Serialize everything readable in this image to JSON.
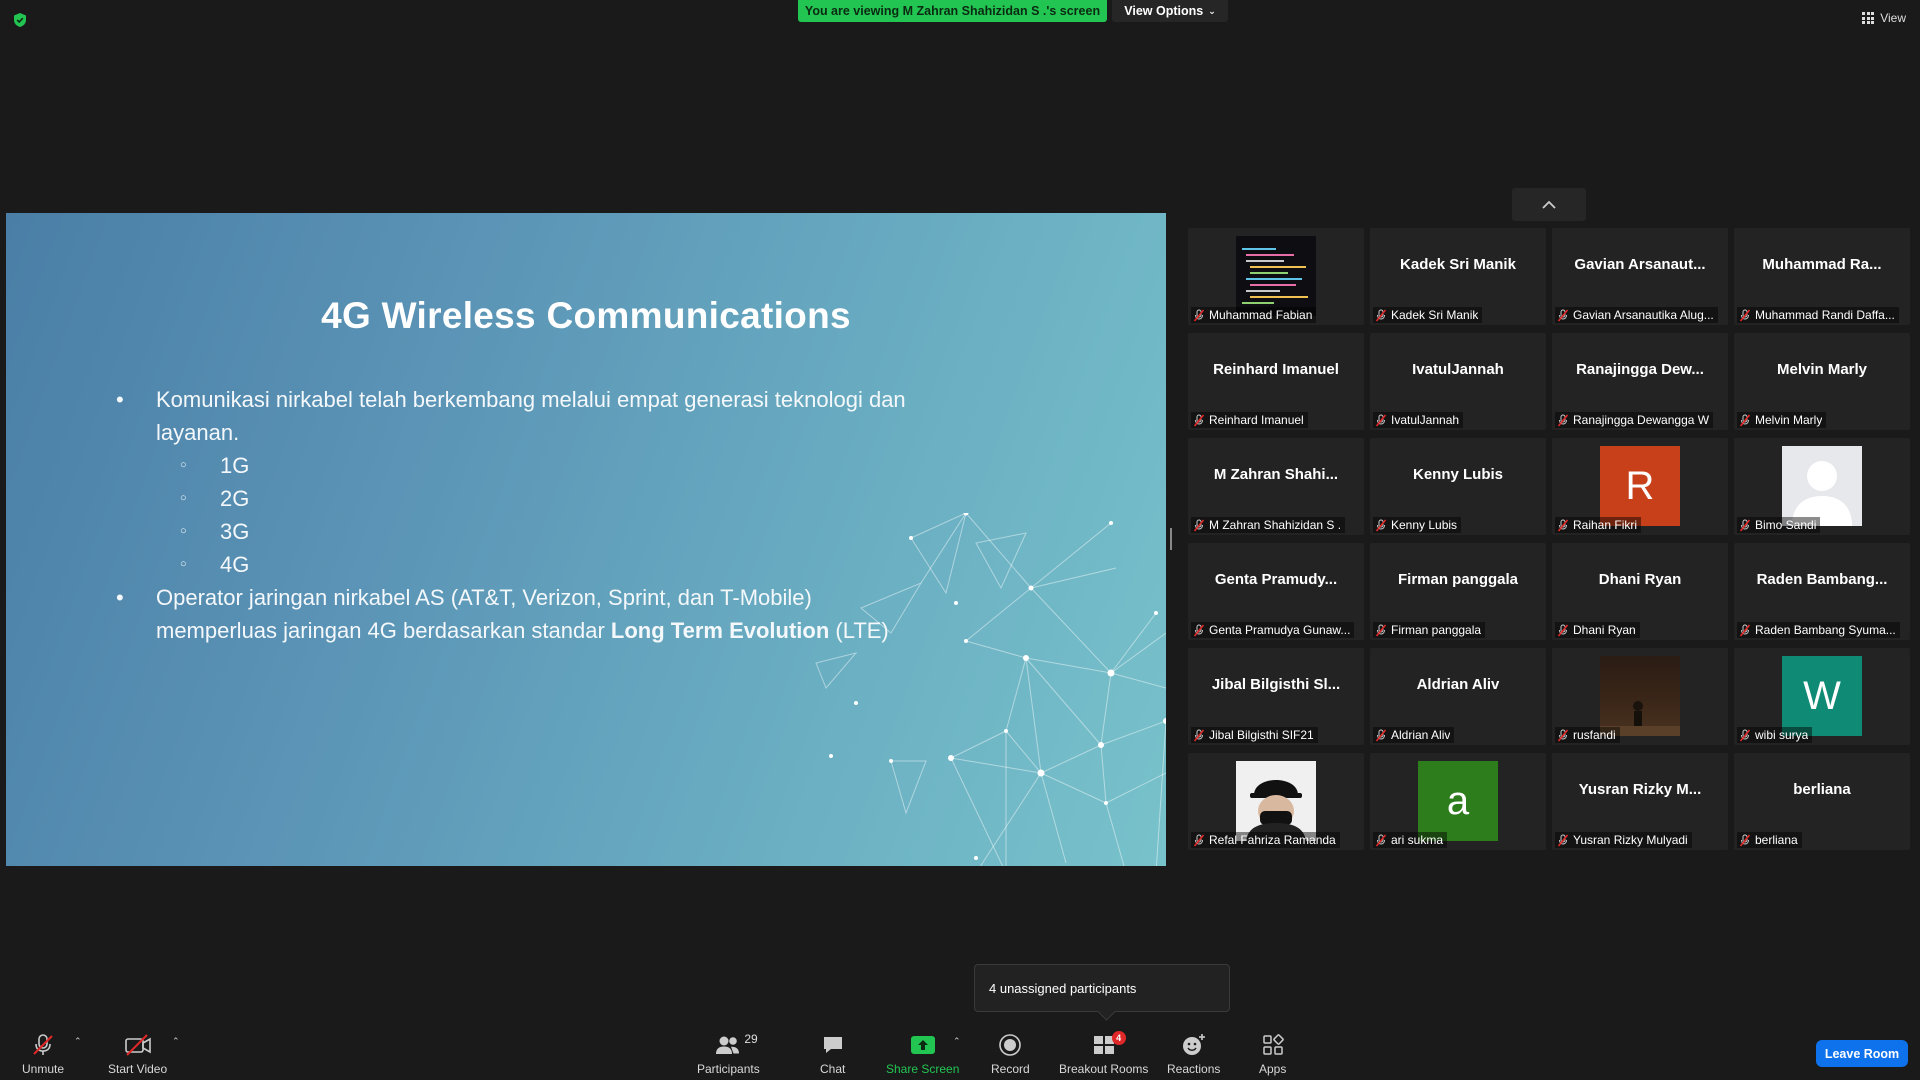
{
  "top_bar": {
    "viewing_banner": "You are viewing M Zahran Shahizidan S .'s screen",
    "view_options_label": "View Options",
    "view_label": "View"
  },
  "slide": {
    "title": "4G Wireless Communications",
    "bullet1": "Komunikasi nirkabel telah berkembang melalui empat generasi teknologi dan layanan.",
    "sub_items": [
      "1G",
      "2G",
      "3G",
      "4G"
    ],
    "bullet2_part1": "Operator jaringan nirkabel AS (AT&T, Verizon, Sprint, dan T-Mobile) memperluas jaringan 4G berdasarkan standar ",
    "bullet2_strong": "Long Term Evolution",
    "bullet2_part2": " (LTE)"
  },
  "gallery": {
    "tiles": [
      {
        "display": "Muhammad Fabian",
        "label": "Muhammad Fabian",
        "kind": "video-code"
      },
      {
        "display": "Kadek Sri Manik",
        "label": "Kadek Sri Manik",
        "kind": "name"
      },
      {
        "display": "Gavian  Arsanaut...",
        "label": "Gavian Arsanautika Alug...",
        "kind": "name"
      },
      {
        "display": "Muhammad  Ra...",
        "label": "Muhammad Randi Daffa...",
        "kind": "name"
      },
      {
        "display": "Reinhard Imanuel",
        "label": "Reinhard Imanuel",
        "kind": "name"
      },
      {
        "display": "IvatulJannah",
        "label": "IvatulJannah",
        "kind": "name"
      },
      {
        "display": "Ranajingga  Dew...",
        "label": "Ranajingga Dewangga W",
        "kind": "name"
      },
      {
        "display": "Melvin Marly",
        "label": "Melvin Marly",
        "kind": "name"
      },
      {
        "display": "M  Zahran  Shahi...",
        "label": "M Zahran Shahizidan S .",
        "kind": "name"
      },
      {
        "display": "Kenny Lubis",
        "label": "Kenny Lubis",
        "kind": "name"
      },
      {
        "display": "R",
        "label": "Raihan Fikri",
        "kind": "letter",
        "color": "#c8401a"
      },
      {
        "display": "",
        "label": "Bimo Sandi",
        "kind": "default-avatar"
      },
      {
        "display": "Genta  Pramudy...",
        "label": "Genta Pramudya Gunaw...",
        "kind": "name"
      },
      {
        "display": "Firman panggala",
        "label": "Firman panggala",
        "kind": "name"
      },
      {
        "display": "Dhani Ryan",
        "label": "Dhani Ryan",
        "kind": "name"
      },
      {
        "display": "Raden  Bambang...",
        "label": "Raden Bambang Syuma...",
        "kind": "name"
      },
      {
        "display": "Jibal  Bilgisthi  Sl...",
        "label": "Jibal Bilgisthi SIF21",
        "kind": "name"
      },
      {
        "display": "Aldrian Aliv",
        "label": "Aldrian Aliv",
        "kind": "name"
      },
      {
        "display": "",
        "label": "rusfandi",
        "kind": "photo-dark"
      },
      {
        "display": "W",
        "label": "wibi surya",
        "kind": "letter",
        "color": "#0f8a74"
      },
      {
        "display": "",
        "label": "Refal Fahriza Ramanda",
        "kind": "photo-cap"
      },
      {
        "display": "a",
        "label": "ari sukma",
        "kind": "letter",
        "color": "#2e7d1c"
      },
      {
        "display": "Yusran  Rizky  M...",
        "label": "Yusran Rizky Mulyadi",
        "kind": "name"
      },
      {
        "display": "berliana",
        "label": "berliana",
        "kind": "name"
      }
    ]
  },
  "popover": {
    "unassigned_text": "4 unassigned participants"
  },
  "toolbar": {
    "unmute": "Unmute",
    "start_video": "Start Video",
    "participants": "Participants",
    "participants_count": "29",
    "chat": "Chat",
    "share_screen": "Share Screen",
    "record": "Record",
    "breakout_rooms": "Breakout Rooms",
    "breakout_badge": "4",
    "reactions": "Reactions",
    "apps": "Apps",
    "leave_room": "Leave Room"
  },
  "colors": {
    "share_green": "#23c552",
    "leave_blue": "#0e72ed",
    "mute_red": "#e02828"
  }
}
